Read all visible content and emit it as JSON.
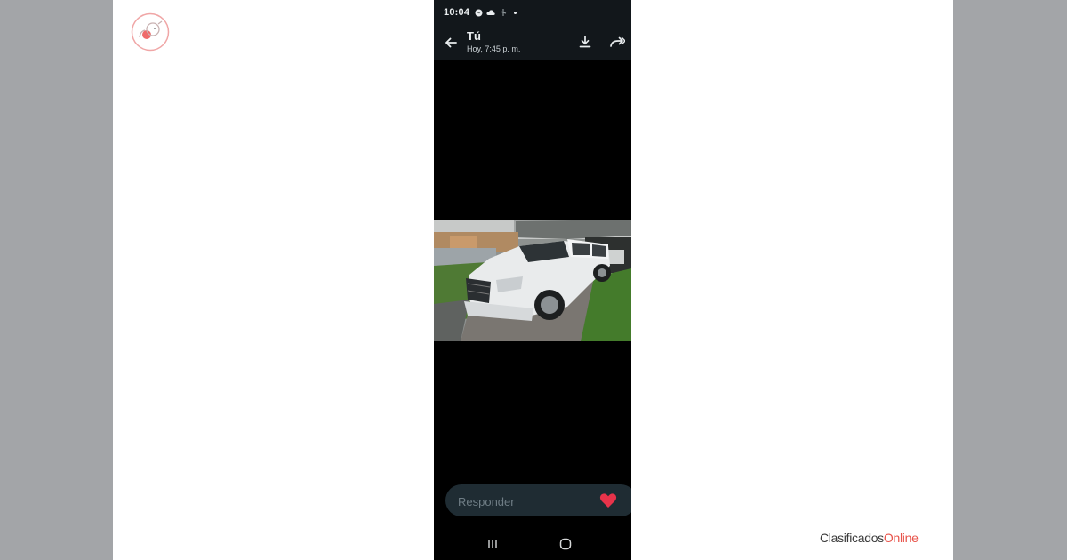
{
  "status_bar": {
    "time": "10:04"
  },
  "header": {
    "title": "Tú",
    "subtitle": "Hoy, 7:45 p. m."
  },
  "reply": {
    "placeholder": "Responder"
  },
  "brand": {
    "name": "Clasificados",
    "accent": "Online"
  },
  "icons": {
    "back": "arrow-left-icon",
    "download": "download-icon",
    "forward": "forward-icon",
    "heart": "heart-icon",
    "recents": "recents-nav-icon",
    "home": "home-nav-icon"
  },
  "colors": {
    "page_bg": "#a3a5a8",
    "canvas_bg": "#ffffff",
    "phone_bar": "#12171b",
    "reply_bg": "#1f2c33",
    "heart": "#e8334a",
    "brand_accent": "#e8534a"
  }
}
